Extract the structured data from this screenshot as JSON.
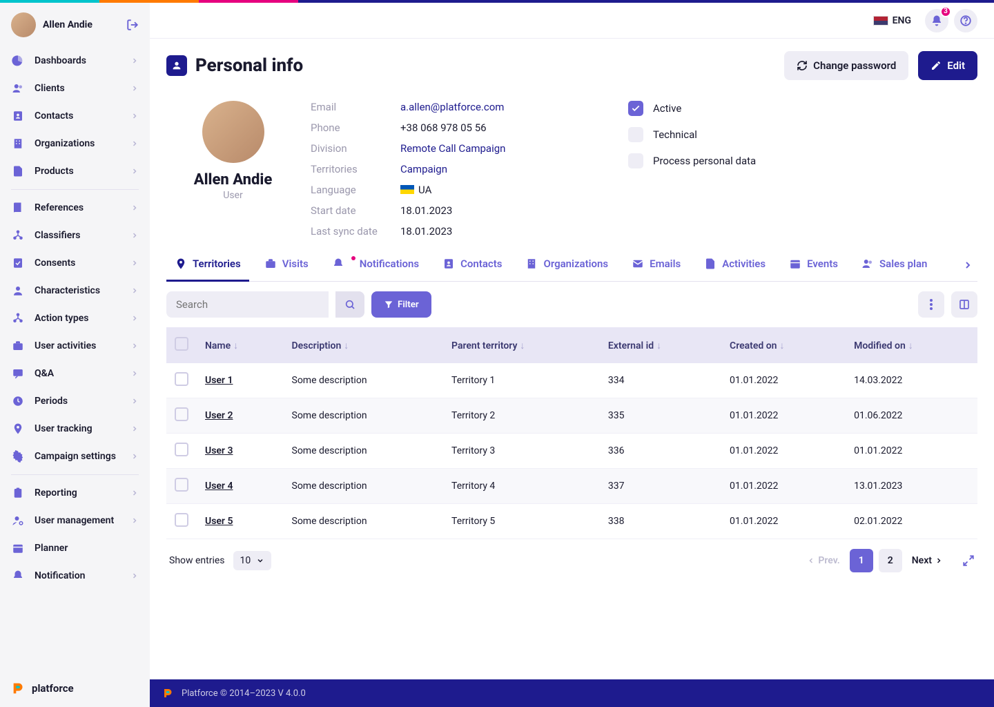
{
  "user": {
    "name": "Allen Andie"
  },
  "sidebar": {
    "groups": [
      [
        {
          "icon": "pie",
          "label": "Dashboards"
        },
        {
          "icon": "users",
          "label": "Clients"
        },
        {
          "icon": "contacts",
          "label": "Contacts"
        },
        {
          "icon": "building",
          "label": "Organizations"
        },
        {
          "icon": "doc",
          "label": "Products"
        }
      ],
      [
        {
          "icon": "book",
          "label": "References"
        },
        {
          "icon": "tree",
          "label": "Classifiers"
        },
        {
          "icon": "consent",
          "label": "Consents"
        },
        {
          "icon": "person",
          "label": "Characteristics"
        },
        {
          "icon": "tree",
          "label": "Action types"
        },
        {
          "icon": "briefcase",
          "label": "User activities"
        },
        {
          "icon": "qa",
          "label": "Q&A"
        },
        {
          "icon": "clock",
          "label": "Periods"
        },
        {
          "icon": "pin",
          "label": "User tracking"
        },
        {
          "icon": "gear",
          "label": "Campaign settings"
        }
      ],
      [
        {
          "icon": "clip",
          "label": "Reporting"
        },
        {
          "icon": "user-cog",
          "label": "User management"
        },
        {
          "icon": "calendar",
          "label": "Planner",
          "no_chev": true
        },
        {
          "icon": "bell",
          "label": "Notification"
        }
      ]
    ]
  },
  "brand": "platforce",
  "lang": "ENG",
  "notif_count": "3",
  "page_title": "Personal info",
  "buttons": {
    "change_password": "Change password",
    "edit": "Edit"
  },
  "profile": {
    "name": "Allen Andie",
    "role": "User"
  },
  "fields": [
    {
      "label": "Email",
      "value": "a.allen@platforce.com",
      "link": true
    },
    {
      "label": "Phone",
      "value": "+38 068 978 05 56"
    },
    {
      "label": "Division",
      "value": "Remote Call Campaign",
      "link": true
    },
    {
      "label": "Territories",
      "value": "Campaign",
      "link": true
    },
    {
      "label": "Language",
      "value": "UA",
      "flag": "ua"
    },
    {
      "label": "Start date",
      "value": "18.01.2023"
    },
    {
      "label": "Last sync date",
      "value": "18.01.2023"
    }
  ],
  "checks": [
    {
      "label": "Active",
      "on": true
    },
    {
      "label": "Technical",
      "on": false
    },
    {
      "label": "Process personal data",
      "on": false
    }
  ],
  "tabs": [
    {
      "icon": "pin",
      "label": "Territories",
      "active": true
    },
    {
      "icon": "briefcase",
      "label": "Visits"
    },
    {
      "icon": "bell",
      "label": "Notifications",
      "dot": true
    },
    {
      "icon": "contacts",
      "label": "Contacts"
    },
    {
      "icon": "building",
      "label": "Organizations"
    },
    {
      "icon": "mail",
      "label": "Emails"
    },
    {
      "icon": "doc",
      "label": "Activities"
    },
    {
      "icon": "calendar",
      "label": "Events"
    },
    {
      "icon": "users",
      "label": "Sales plan"
    }
  ],
  "search_placeholder": "Search",
  "filter_label": "Filter",
  "columns": [
    "Name",
    "Description",
    "Parent territory",
    "External id",
    "Created on",
    "Modified on"
  ],
  "rows": [
    {
      "name": "User 1",
      "description": "Some description",
      "parent": "Territory 1",
      "ext": "334",
      "created": "01.01.2022",
      "modified": "14.03.2022"
    },
    {
      "name": "User 2",
      "description": "Some description",
      "parent": "Territory 2",
      "ext": "335",
      "created": "01.01.2022",
      "modified": "01.06.2022"
    },
    {
      "name": "User 3",
      "description": "Some description",
      "parent": "Territory 3",
      "ext": "336",
      "created": "01.01.2022",
      "modified": "01.01.2022"
    },
    {
      "name": "User 4",
      "description": "Some description",
      "parent": "Territory 4",
      "ext": "337",
      "created": "01.01.2022",
      "modified": "13.01.2023"
    },
    {
      "name": "User 5",
      "description": "Some description",
      "parent": "Territory 5",
      "ext": "338",
      "created": "01.01.2022",
      "modified": "02.01.2022"
    }
  ],
  "show_entries_label": "Show entries",
  "page_size": "10",
  "pagination": {
    "prev": "Prev.",
    "next": "Next",
    "pages": [
      "1",
      "2"
    ],
    "active": "1"
  },
  "footer": "Platforce © 2014–2023 V 4.0.0"
}
